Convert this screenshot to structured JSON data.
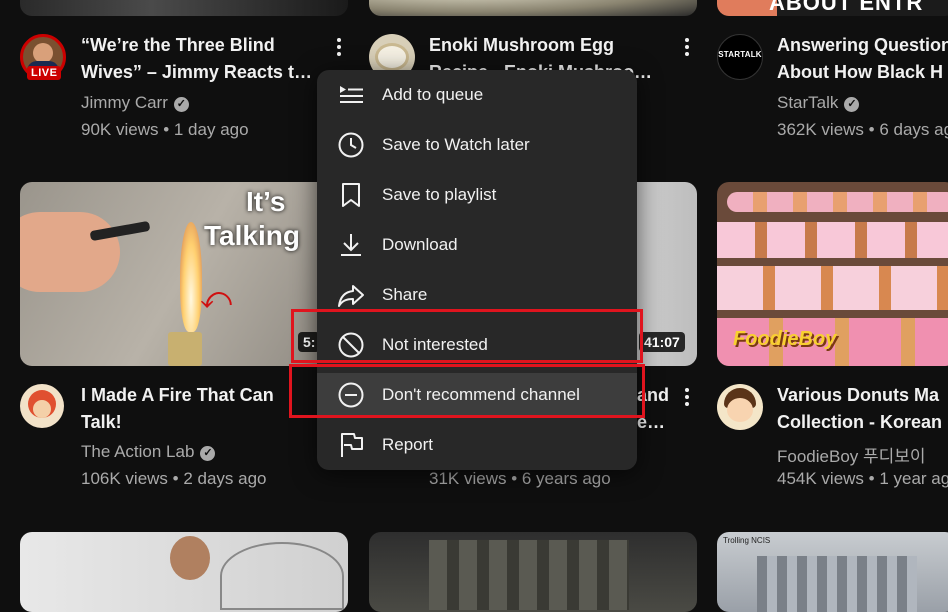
{
  "colors": {
    "background": "#0f0f0f",
    "menu": "#282828",
    "highlight": "#e0141e",
    "text": "#f1f1f1",
    "muted": "#aaaaaa"
  },
  "row1": [
    {
      "title_l1": "“We’re the Three Blind",
      "title_l2": "Wives” – Jimmy Reacts t…",
      "channel": "Jimmy Carr",
      "stats": "90K views • 1 day ago",
      "live": "LIVE"
    },
    {
      "title_l1": "Enoki Mushroom Egg",
      "title_l2": "Recipe · Enoki Mushroo…"
    },
    {
      "title_l1": "Answering Questions",
      "title_l2": "About How Black H",
      "channel": "StarTalk",
      "stats": "362K views • 6 days ag",
      "avatar_text": "STARTALK",
      "thumb_text": "ABOUT ENTR"
    }
  ],
  "row2": [
    {
      "title_l1": "I Made A Fire That Can",
      "title_l2": "Talk!",
      "channel": "The Action Lab",
      "stats": "106K views • 2 days ago",
      "thumb_text_1": "It’s",
      "thumb_text_2": "Talking",
      "duration": "5:"
    },
    {
      "title_l1": "and",
      "title_l2": "e…",
      "stats": "31K views • 6 years ago",
      "duration": "41:07"
    },
    {
      "title_l1": "Various Donuts Ma",
      "title_l2": "Collection - Korean",
      "channel": "FoodieBoy 푸디보이",
      "stats": "454K views • 1 year ag",
      "thumb_logo": "FoodieBoy"
    }
  ],
  "row3": [
    {
      "thumb_text": "Trolling NCIS"
    }
  ],
  "menu": {
    "items": [
      {
        "label": "Add to queue",
        "icon": "queue-icon"
      },
      {
        "label": "Save to Watch later",
        "icon": "clock-icon"
      },
      {
        "label": "Save to playlist",
        "icon": "bookmark-icon"
      },
      {
        "label": "Download",
        "icon": "download-icon"
      },
      {
        "label": "Share",
        "icon": "share-icon"
      },
      {
        "label": "Not interested",
        "icon": "block-icon"
      },
      {
        "label": "Don't recommend channel",
        "icon": "minus-circle-icon"
      },
      {
        "label": "Report",
        "icon": "flag-icon"
      }
    ]
  }
}
